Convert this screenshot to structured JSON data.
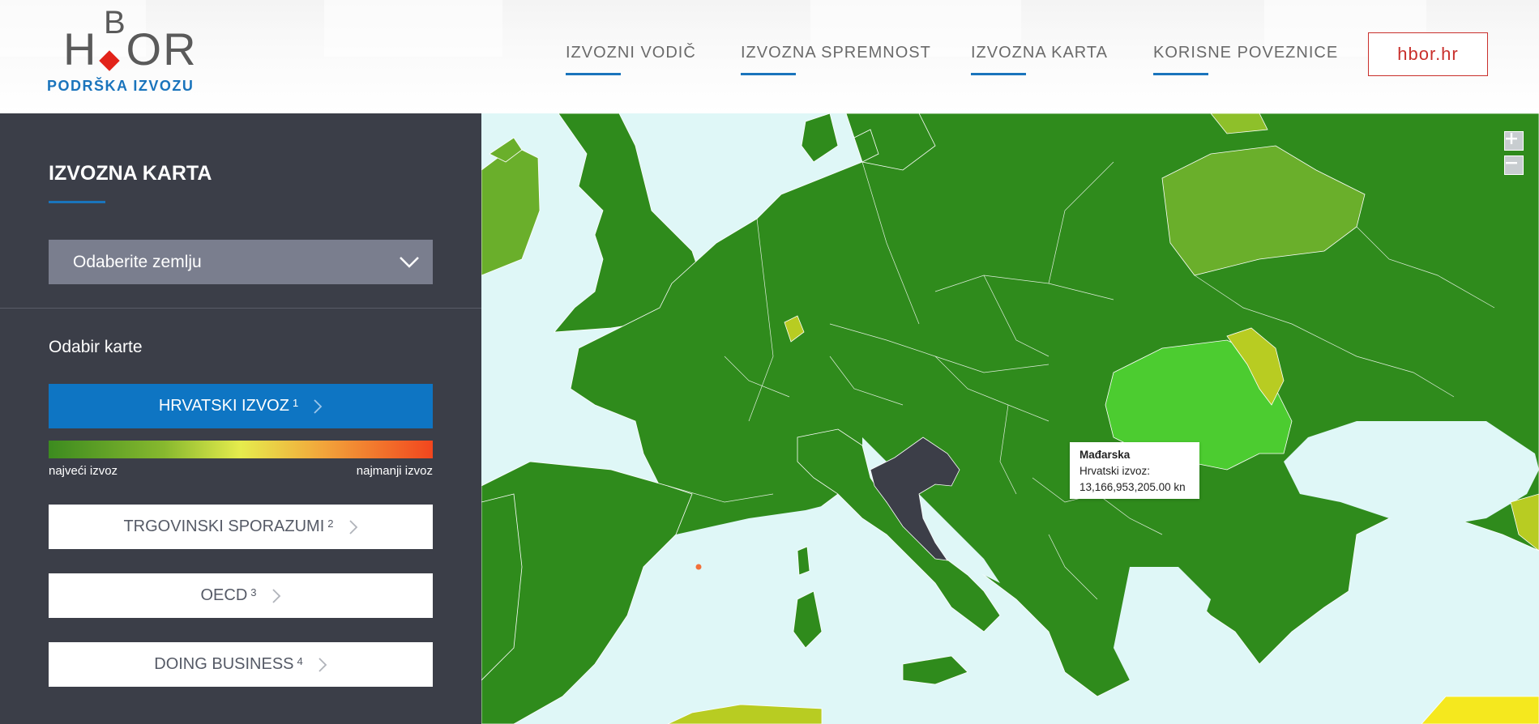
{
  "brand": {
    "logo_text": "HBOR",
    "logo_subtitle": "PODRŠKA IZVOZU"
  },
  "nav": {
    "items": [
      {
        "label": "IZVOZNI VODIČ"
      },
      {
        "label": "IZVOZNA SPREMNOST"
      },
      {
        "label": "IZVOZNA KARTA"
      },
      {
        "label": "KORISNE POVEZNICE"
      }
    ],
    "external_link": "hbor.hr"
  },
  "sidebar": {
    "title": "IZVOZNA KARTA",
    "country_select_placeholder": "Odaberite zemlju",
    "section_label": "Odabir karte",
    "map_buttons": [
      {
        "label": "HRVATSKI IZVOZ",
        "sup": "1",
        "active": true
      },
      {
        "label": "TRGOVINSKI SPORAZUMI",
        "sup": "2",
        "active": false
      },
      {
        "label": "OECD",
        "sup": "3",
        "active": false
      },
      {
        "label": "DOING BUSINESS",
        "sup": "4",
        "active": false
      }
    ],
    "legend": {
      "left_label": "najveći izvoz",
      "right_label": "najmanji izvoz"
    }
  },
  "map": {
    "zoom_in_icon": "plus-icon",
    "zoom_out_icon": "minus-icon",
    "tooltip": {
      "country": "Mađarska",
      "label": "Hrvatski izvoz:",
      "value": "13,166,953,205.00 kn"
    },
    "colors": {
      "sea": "#dff7f7",
      "high_export": "#2f8b1c",
      "light_green": "#6aaf2b",
      "bright_green": "#4ccc30",
      "yellow_green": "#b8cc22",
      "yellow": "#f5e81e",
      "croatia": "#3c3e48",
      "accent_blue": "#1a74bc",
      "accent_red": "#c9302c"
    }
  }
}
